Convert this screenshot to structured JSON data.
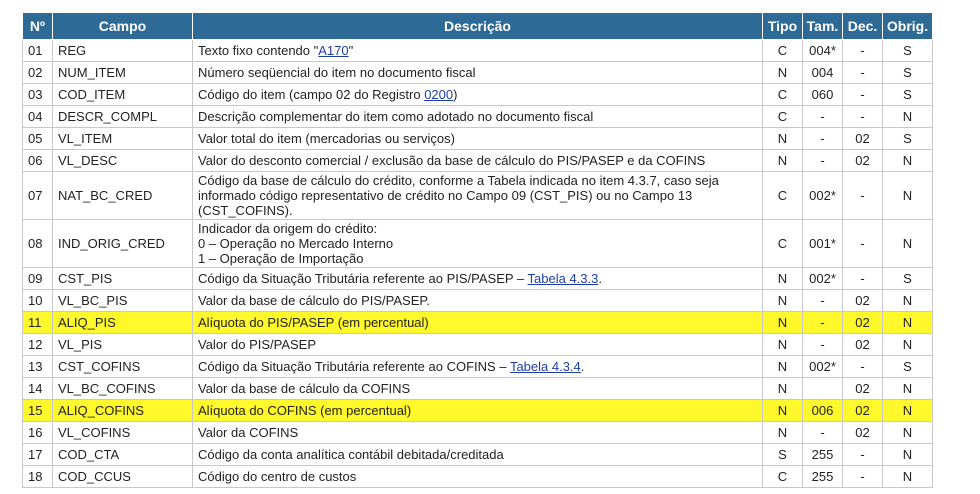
{
  "headers": {
    "num": "Nº",
    "campo": "Campo",
    "descricao": "Descrição",
    "tipo": "Tipo",
    "tam": "Tam.",
    "dec": "Dec.",
    "obrig": "Obrig."
  },
  "highlight_color": "#fff82a",
  "header_color": "#2d6a96",
  "link_color": "#1f3fa8",
  "rows": [
    {
      "num": "01",
      "campo": "REG",
      "desc": [
        "Texto fixo contendo \"",
        "\""
      ],
      "link": "A170",
      "tipo": "C",
      "tam": "004*",
      "dec": "-",
      "obrig": "S"
    },
    {
      "num": "02",
      "campo": "NUM_ITEM",
      "desc": [
        "Número seqüencial do item no documento fiscal"
      ],
      "tipo": "N",
      "tam": "004",
      "dec": "-",
      "obrig": "S"
    },
    {
      "num": "03",
      "campo": "COD_ITEM",
      "desc": [
        "Código do item (campo 02 do Registro ",
        ")"
      ],
      "link": "0200",
      "tipo": "C",
      "tam": "060",
      "dec": "-",
      "obrig": "S"
    },
    {
      "num": "04",
      "campo": "DESCR_COMPL",
      "desc": [
        "Descrição complementar do item como adotado no documento fiscal"
      ],
      "tipo": "C",
      "tam": "-",
      "dec": "-",
      "obrig": "N"
    },
    {
      "num": "05",
      "campo": "VL_ITEM",
      "desc": [
        "Valor total do item (mercadorias ou serviços)"
      ],
      "tipo": "N",
      "tam": "-",
      "dec": "02",
      "obrig": "S"
    },
    {
      "num": "06",
      "campo": "VL_DESC",
      "desc": [
        "Valor do desconto comercial / exclusão da base de cálculo do PIS/PASEP e da COFINS"
      ],
      "tipo": "N",
      "tam": "-",
      "dec": "02",
      "obrig": "N"
    },
    {
      "num": "07",
      "campo": "NAT_BC_CRED",
      "desc": [
        "Código da base de cálculo do crédito, conforme a Tabela indicada no item 4.3.7, caso seja informado código representativo de crédito no Campo 09 (CST_PIS) ou no Campo 13 (CST_COFINS)."
      ],
      "tipo": "C",
      "tam": "002*",
      "dec": "-",
      "obrig": "N"
    },
    {
      "num": "08",
      "campo": "IND_ORIG_CRED",
      "desc_lines": [
        "Indicador da origem do crédito:",
        "0 – Operação no Mercado Interno",
        "1 – Operação de Importação"
      ],
      "tipo": "C",
      "tam": "001*",
      "dec": "-",
      "obrig": "N"
    },
    {
      "num": "09",
      "campo": "CST_PIS",
      "desc": [
        "Código da Situação Tributária referente ao PIS/PASEP – ",
        "."
      ],
      "link": "Tabela 4.3.3",
      "tipo": "N",
      "tam": "002*",
      "dec": "-",
      "obrig": "S"
    },
    {
      "num": "10",
      "campo": "VL_BC_PIS",
      "desc": [
        "Valor da base de cálculo do PIS/PASEP."
      ],
      "tipo": "N",
      "tam": "-",
      "dec": "02",
      "obrig": "N"
    },
    {
      "num": "11",
      "campo": "ALIQ_PIS",
      "desc": [
        "Alíquota do PIS/PASEP (em percentual)"
      ],
      "tipo": "N",
      "tam": "-",
      "dec": "02",
      "obrig": "N",
      "highlight": true
    },
    {
      "num": "12",
      "campo": "VL_PIS",
      "desc": [
        "Valor do PIS/PASEP"
      ],
      "tipo": "N",
      "tam": "-",
      "dec": "02",
      "obrig": "N"
    },
    {
      "num": "13",
      "campo": "CST_COFINS",
      "desc": [
        "Código da Situação Tributária referente ao COFINS – ",
        "."
      ],
      "link": "Tabela 4.3.4",
      "tipo": "N",
      "tam": "002*",
      "dec": "-",
      "obrig": "S"
    },
    {
      "num": "14",
      "campo": "VL_BC_COFINS",
      "desc": [
        "Valor da base de cálculo da COFINS"
      ],
      "tipo": "N",
      "tam": "",
      "dec": "02",
      "obrig": "N"
    },
    {
      "num": "15",
      "campo": "ALIQ_COFINS",
      "desc": [
        "Alíquota do COFINS (em percentual)"
      ],
      "tipo": "N",
      "tam": "006",
      "dec": "02",
      "obrig": "N",
      "highlight": true
    },
    {
      "num": "16",
      "campo": "VL_COFINS",
      "desc": [
        "Valor da COFINS"
      ],
      "tipo": "N",
      "tam": "-",
      "dec": "02",
      "obrig": "N"
    },
    {
      "num": "17",
      "campo": "COD_CTA",
      "desc": [
        "Código da conta analítica contábil debitada/creditada"
      ],
      "tipo": "S",
      "tam": "255",
      "dec": "-",
      "obrig": "N"
    },
    {
      "num": "18",
      "campo": "COD_CCUS",
      "desc": [
        "Código do centro de custos"
      ],
      "tipo": "C",
      "tam": "255",
      "dec": "-",
      "obrig": "N"
    }
  ]
}
